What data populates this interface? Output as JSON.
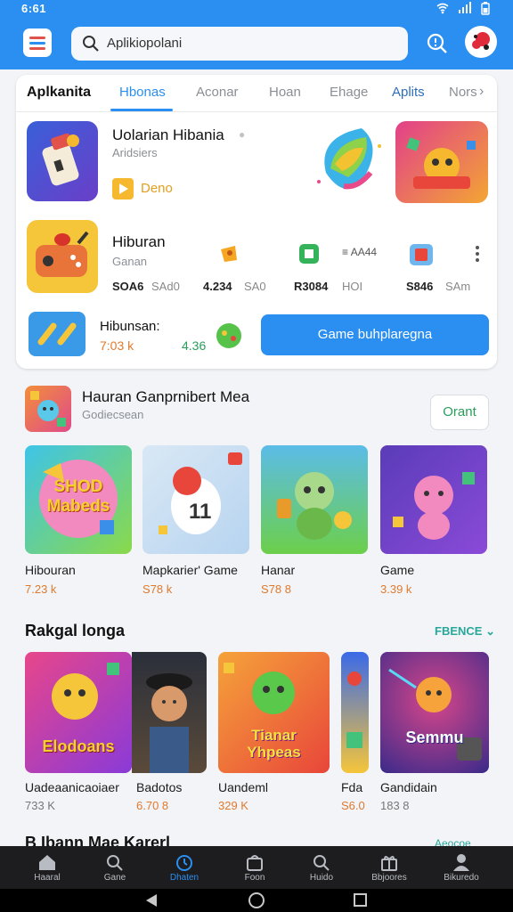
{
  "status": {
    "time": "6:61",
    "icons": [
      "wifi-icon",
      "signal-icon",
      "battery-icon"
    ]
  },
  "search": {
    "value": "Aplikiopolani",
    "icon": "search-icon"
  },
  "colors": {
    "primary": "#2a8ff0",
    "accent_orange": "#e07a2f",
    "accent_green": "#2a9d5a",
    "nav_bg": "#1d1d1f"
  },
  "tabs": {
    "title": "Aplkanita",
    "items": [
      "Hbonas",
      "Aconar",
      "Hoan",
      "Ehage",
      "Aplits",
      "Nors"
    ]
  },
  "featured": {
    "app1": {
      "name": "Uolarian Hibania",
      "sub": "Aridsiers",
      "badge": "Deno"
    },
    "app2": {
      "name": "Hiburan",
      "sub": "Ganan"
    },
    "stats": [
      {
        "value": "SOA6",
        "unit": "SAd0"
      },
      {
        "value": "4.234",
        "unit": "SA0"
      },
      {
        "value": "R3084",
        "unit": "HOI"
      },
      {
        "value": "S846",
        "unit": "SAm"
      }
    ],
    "mini_meta": "AA44",
    "app3": {
      "name": "Hibunsan:",
      "count": "7:03 k",
      "rating": "4.36"
    },
    "cta": "Game buhplaregna"
  },
  "section2": {
    "title": "Hauran Ganprnibert Mea",
    "sub": "Godiecsean",
    "button": "Orant",
    "games": [
      {
        "name": "Hibouran",
        "stat": "7.23 k"
      },
      {
        "name": "Mapkarier' Game",
        "stat": "S78 k"
      },
      {
        "name": "Hanar",
        "stat": "S78 8"
      },
      {
        "name": "Game",
        "stat": "3.39 k"
      }
    ]
  },
  "section3": {
    "title": "Rakgal longa",
    "see_more": "FBENCE",
    "items": [
      {
        "name": "Uadeaanicaoiaer",
        "stat": "733 K"
      },
      {
        "name": "Badotos",
        "stat": "6.70 8"
      },
      {
        "name": "Uandeml",
        "stat": "329 K"
      },
      {
        "name": "Fda",
        "stat": "S6.0"
      },
      {
        "name": "Gandidain",
        "stat": "183 8"
      }
    ],
    "tile_text": [
      "Elodoans",
      "Tianar Yhpeas",
      "Semmu"
    ]
  },
  "section2_tile_text": "SHOD Mabeds",
  "next_section": {
    "title": "B Ibann Mae Karerl",
    "more": "Aeocoe"
  },
  "bottom_nav": [
    {
      "label": "Haaral",
      "icon": "home-icon"
    },
    {
      "label": "Gane",
      "icon": "search-icon"
    },
    {
      "label": "Dhaten",
      "icon": "clock-icon"
    },
    {
      "label": "Foon",
      "icon": "bag-icon"
    },
    {
      "label": "Huido",
      "icon": "search-icon"
    },
    {
      "label": "Bbjoores",
      "icon": "gift-icon"
    },
    {
      "label": "Bikuredo",
      "icon": "person-icon"
    }
  ]
}
